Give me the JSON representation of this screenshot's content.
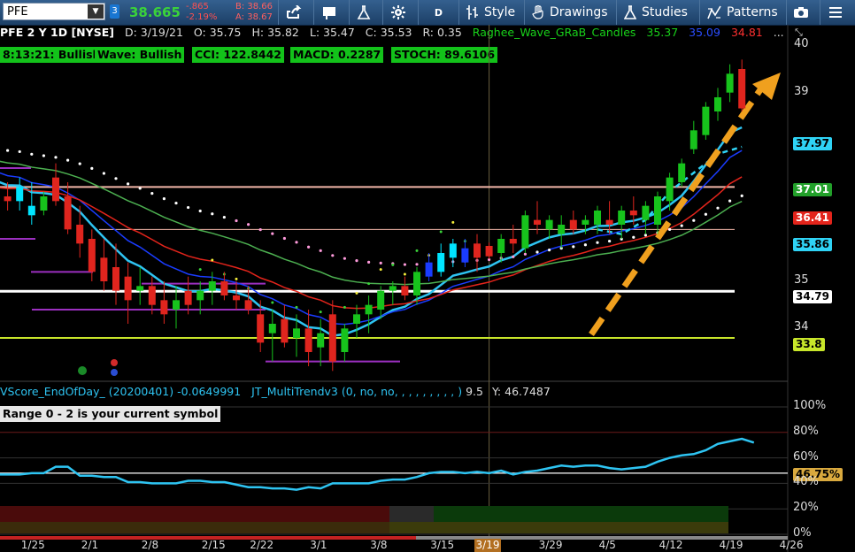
{
  "toolbar": {
    "symbol": "PFE",
    "badge": "3",
    "last": "38.665",
    "net_change": "-.865",
    "pct_change": "-2.19%",
    "bid": "B: 38.66",
    "ask": "A: 38.67",
    "period_button": "D",
    "style_label": "Style",
    "drawings_label": "Drawings",
    "studies_label": "Studies",
    "patterns_label": "Patterns"
  },
  "info": {
    "title": "PFE 2 Y 1D [NYSE]",
    "date": "D: 3/19/21",
    "open": "O: 35.75",
    "high": "H: 35.82",
    "low": "L: 35.47",
    "close": "C: 35.53",
    "range": "R: 0.35",
    "study_name": "Raghee_Wave_GRaB_Candles",
    "study_v1": "35.37",
    "study_v2": "35.09",
    "study_v3": "34.81",
    "more": "..."
  },
  "status": {
    "trend": "8:13:21: Bullish",
    "wave": "Wave: Bullish",
    "cci": "CCI: 122.8442",
    "macd": "MACD: 0.2287",
    "stoch": "STOCH: 89.6106"
  },
  "lower": {
    "study1": "VScore_EndOfDay_ (20200401)",
    "study1_val": "-0.0649991",
    "study2": "JT_MultiTrendv3 (0, no, no, , , , , , , , , )",
    "study2_val": "9.5",
    "study2_y": "Y: 46.7487",
    "range_note": "Range 0 - 2 is your current symbol"
  },
  "price_labels": [
    "37.97",
    "37.01",
    "36.41",
    "35.86",
    "34.79",
    "33.8"
  ],
  "colors": {
    "up": "#17c31c",
    "down": "#e0251e",
    "up_bright": "#00e5ff",
    "down_bright": "#ff3030",
    "ema_red": "#e3241b",
    "ema_blue": "#1a3cff",
    "ema_green": "#4caf50",
    "ema_cyan": "#2ec4f2",
    "arrow": "#f0a01e"
  },
  "chart_data": [
    {
      "type": "candlestick",
      "title": "PFE 2 Y 1D [NYSE]",
      "x": [
        "1/20",
        "1/21",
        "1/22",
        "1/25",
        "1/26",
        "1/27",
        "1/28",
        "1/29",
        "2/1",
        "2/2",
        "2/3",
        "2/4",
        "2/5",
        "2/8",
        "2/9",
        "2/10",
        "2/11",
        "2/12",
        "2/16",
        "2/17",
        "2/18",
        "2/19",
        "2/22",
        "2/23",
        "2/24",
        "2/25",
        "2/26",
        "3/1",
        "3/2",
        "3/3",
        "3/4",
        "3/5",
        "3/8",
        "3/9",
        "3/10",
        "3/11",
        "3/12",
        "3/15",
        "3/16",
        "3/17",
        "3/18",
        "3/19",
        "3/22",
        "3/23",
        "3/24",
        "3/25",
        "3/26",
        "3/29",
        "3/30",
        "3/31",
        "4/1",
        "4/5",
        "4/6",
        "4/7",
        "4/8",
        "4/9",
        "4/12",
        "4/13",
        "4/14",
        "4/15",
        "4/16",
        "4/19",
        "4/20"
      ],
      "x_ticks": [
        "1/25",
        "2/1",
        "2/8",
        "2/15",
        "2/22",
        "3/1",
        "3/8",
        "3/15",
        "3/19",
        "3/29",
        "4/5",
        "4/12",
        "4/19",
        "4/26"
      ],
      "ohlc": [
        [
          36.9,
          37.2,
          36.6,
          36.9
        ],
        [
          36.8,
          37.1,
          36.5,
          36.7
        ],
        [
          36.7,
          37.2,
          36.5,
          37.0
        ],
        [
          36.6,
          37.1,
          36.2,
          36.4
        ],
        [
          36.5,
          36.9,
          36.4,
          36.8
        ],
        [
          37.2,
          37.5,
          36.6,
          36.7
        ],
        [
          36.8,
          37.1,
          36.0,
          36.1
        ],
        [
          36.2,
          36.6,
          35.5,
          35.8
        ],
        [
          35.9,
          36.1,
          35.0,
          35.2
        ],
        [
          35.5,
          35.9,
          34.8,
          35.0
        ],
        [
          35.3,
          35.8,
          34.5,
          34.8
        ],
        [
          35.1,
          35.4,
          34.1,
          34.6
        ],
        [
          34.8,
          35.3,
          34.5,
          34.9
        ],
        [
          34.9,
          35.1,
          34.3,
          34.5
        ],
        [
          34.6,
          35.0,
          34.1,
          34.3
        ],
        [
          34.4,
          34.9,
          34.0,
          34.6
        ],
        [
          34.8,
          35.1,
          34.3,
          34.5
        ],
        [
          34.6,
          35.0,
          34.3,
          34.8
        ],
        [
          34.8,
          35.2,
          34.5,
          35.0
        ],
        [
          35.0,
          35.2,
          34.6,
          34.7
        ],
        [
          34.7,
          35.0,
          34.4,
          34.6
        ],
        [
          34.6,
          34.9,
          34.3,
          34.4
        ],
        [
          34.3,
          34.6,
          33.5,
          33.7
        ],
        [
          33.9,
          34.4,
          33.3,
          34.1
        ],
        [
          34.2,
          34.5,
          33.6,
          33.7
        ],
        [
          33.8,
          34.3,
          33.4,
          34.0
        ],
        [
          34.0,
          34.4,
          33.2,
          33.5
        ],
        [
          33.6,
          34.2,
          33.2,
          33.9
        ],
        [
          34.3,
          34.6,
          33.1,
          33.3
        ],
        [
          33.5,
          34.1,
          33.3,
          34.0
        ],
        [
          34.1,
          34.5,
          33.8,
          34.3
        ],
        [
          34.3,
          34.7,
          33.9,
          34.5
        ],
        [
          34.4,
          34.9,
          34.2,
          34.8
        ],
        [
          34.8,
          35.0,
          34.5,
          34.9
        ],
        [
          34.9,
          35.1,
          34.6,
          34.7
        ],
        [
          34.7,
          35.3,
          34.5,
          35.2
        ],
        [
          35.4,
          35.6,
          35.0,
          35.1
        ],
        [
          35.2,
          35.8,
          35.1,
          35.6
        ],
        [
          35.5,
          35.9,
          35.3,
          35.8
        ],
        [
          35.7,
          35.9,
          35.3,
          35.4
        ],
        [
          35.8,
          36.0,
          35.2,
          35.5
        ],
        [
          35.75,
          35.82,
          35.47,
          35.53
        ],
        [
          35.6,
          36.0,
          35.4,
          35.9
        ],
        [
          35.9,
          36.2,
          35.6,
          35.8
        ],
        [
          35.7,
          36.5,
          35.6,
          36.4
        ],
        [
          36.3,
          36.7,
          36.0,
          36.2
        ],
        [
          36.1,
          36.4,
          35.9,
          36.3
        ],
        [
          36.0,
          36.4,
          35.7,
          36.2
        ],
        [
          36.3,
          36.5,
          36.0,
          36.1
        ],
        [
          36.2,
          36.4,
          36.0,
          36.3
        ],
        [
          36.2,
          36.6,
          36.0,
          36.5
        ],
        [
          36.3,
          36.7,
          36.0,
          36.2
        ],
        [
          36.2,
          36.6,
          35.9,
          36.5
        ],
        [
          36.5,
          36.8,
          36.2,
          36.4
        ],
        [
          36.3,
          36.7,
          36.0,
          36.6
        ],
        [
          36.2,
          36.9,
          36.0,
          36.8
        ],
        [
          36.7,
          37.3,
          36.5,
          37.2
        ],
        [
          37.1,
          37.6,
          37.0,
          37.5
        ],
        [
          37.8,
          38.4,
          37.7,
          38.2
        ],
        [
          38.1,
          38.8,
          38.0,
          38.7
        ],
        [
          38.6,
          39.1,
          38.4,
          38.9
        ],
        [
          39.0,
          39.6,
          38.8,
          39.4
        ],
        [
          39.5,
          39.7,
          38.6,
          38.665
        ]
      ],
      "ylim": [
        32.9,
        40.4
      ],
      "y_ticks": [
        34,
        35,
        39,
        40
      ]
    },
    {
      "type": "line",
      "title": "VScore_EndOfDay_ (20200401)",
      "values": [
        47,
        47,
        47,
        48,
        48,
        53,
        53,
        46,
        46,
        45,
        45,
        41,
        41,
        40,
        40,
        40,
        42,
        42,
        41,
        41,
        39,
        37,
        37,
        36,
        36,
        35,
        37,
        36,
        40,
        40,
        40,
        40,
        42,
        43,
        43,
        45,
        48,
        49,
        49,
        48,
        49,
        48,
        50,
        47,
        49,
        50,
        52,
        54,
        53,
        54,
        54,
        52,
        51,
        52,
        53,
        57,
        60,
        62,
        63,
        66,
        71,
        73,
        75,
        72
      ],
      "y_ticks": [
        "0%",
        "20%",
        "40%",
        "60%",
        "80%",
        "100%"
      ],
      "last_value": "46.75%"
    }
  ]
}
